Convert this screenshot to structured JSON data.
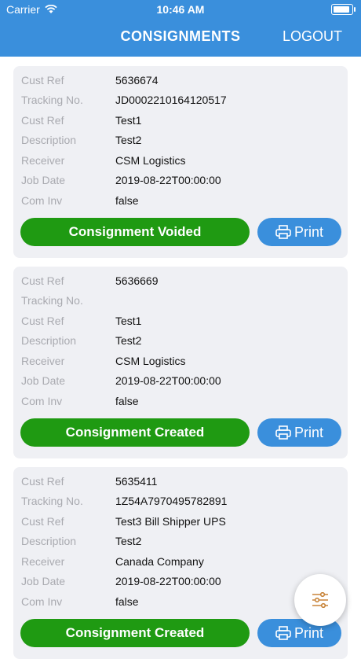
{
  "status_bar": {
    "carrier": "Carrier",
    "time": "10:46 AM"
  },
  "header": {
    "title": "CONSIGNMENTS",
    "logout_label": "LOGOUT"
  },
  "labels": {
    "cust_ref": "Cust Ref",
    "tracking": "Tracking No.",
    "cust_ref2": "Cust Ref",
    "description": "Description",
    "receiver": "Receiver",
    "job_date": "Job Date",
    "com_inv": "Com Inv"
  },
  "print_label": "Print",
  "consignments": [
    {
      "cust_ref": "5636674",
      "tracking": "JD0002210164120517",
      "cust_ref2": "Test1",
      "description": "Test2",
      "receiver": "CSM Logistics",
      "job_date": "2019-08-22T00:00:00",
      "com_inv": "false",
      "status": "Consignment Voided"
    },
    {
      "cust_ref": "5636669",
      "tracking": "",
      "cust_ref2": "Test1",
      "description": "Test2",
      "receiver": "CSM Logistics",
      "job_date": "2019-08-22T00:00:00",
      "com_inv": "false",
      "status": "Consignment Created"
    },
    {
      "cust_ref": "5635411",
      "tracking": "1Z54A7970495782891",
      "cust_ref2": "Test3 Bill Shipper UPS",
      "description": "Test2",
      "receiver": "Canada Company",
      "job_date": "2019-08-22T00:00:00",
      "com_inv": "false",
      "status": "Consignment Created"
    }
  ],
  "colors": {
    "accent": "#3a8fdc",
    "status_green": "#1f9a12",
    "card_bg": "#eff0f4"
  }
}
